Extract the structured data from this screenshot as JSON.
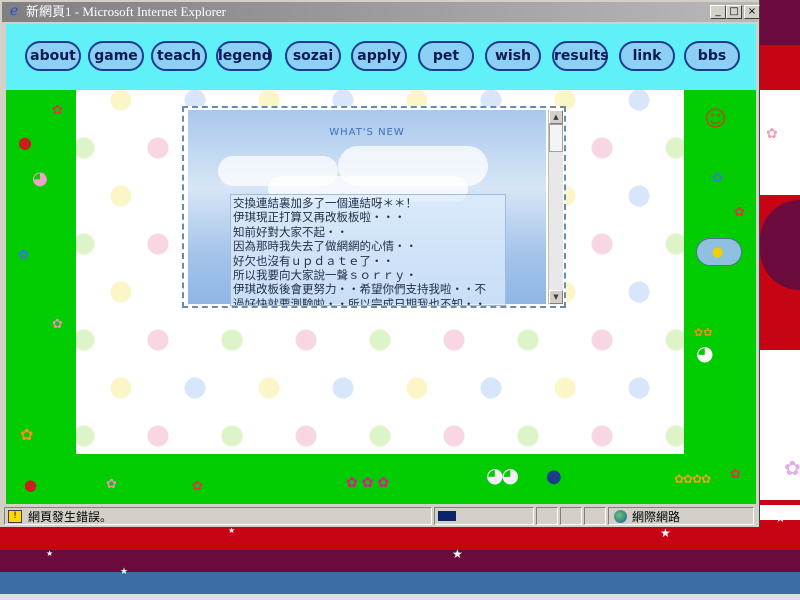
{
  "window": {
    "title": "新網頁1 - Microsoft Internet Explorer",
    "minimize_glyph": "_",
    "maximize_glyph": "□",
    "close_glyph": "×"
  },
  "nav": {
    "items": [
      {
        "label": "about"
      },
      {
        "label": "game"
      },
      {
        "label": "teach"
      },
      {
        "label": "legend"
      },
      {
        "label": "sozai"
      },
      {
        "label": "apply"
      },
      {
        "label": "pet"
      },
      {
        "label": "wish"
      },
      {
        "label": "results"
      },
      {
        "label": "link"
      },
      {
        "label": "bbs"
      }
    ]
  },
  "news": {
    "heading": "WHAT'S NEW",
    "lines": [
      "交換連結裏加多了一個連結呀＊＊！",
      "伊琪現正打算又再改板板啦・・・",
      "知前好對大家不起・・",
      "因為那時我失去了做網網的心情・・",
      "好欠也沒有ｕｐｄａｔｅ了・・",
      "所以我要向大家說一聲ｓｏｒｒｙ・",
      "伊琪改板後會更努力・・希望你們支持我啦・・不",
      "過好快就要測驗啦・・所以完成日期我也不知・・"
    ]
  },
  "status": {
    "message": "網頁發生錯誤。",
    "zone": "網際網路",
    "progress_percent": 20
  },
  "colors": {
    "nav_background": "#5ff0f8",
    "nav_button": "#8cd0f6",
    "side_green": "#00cc00"
  }
}
